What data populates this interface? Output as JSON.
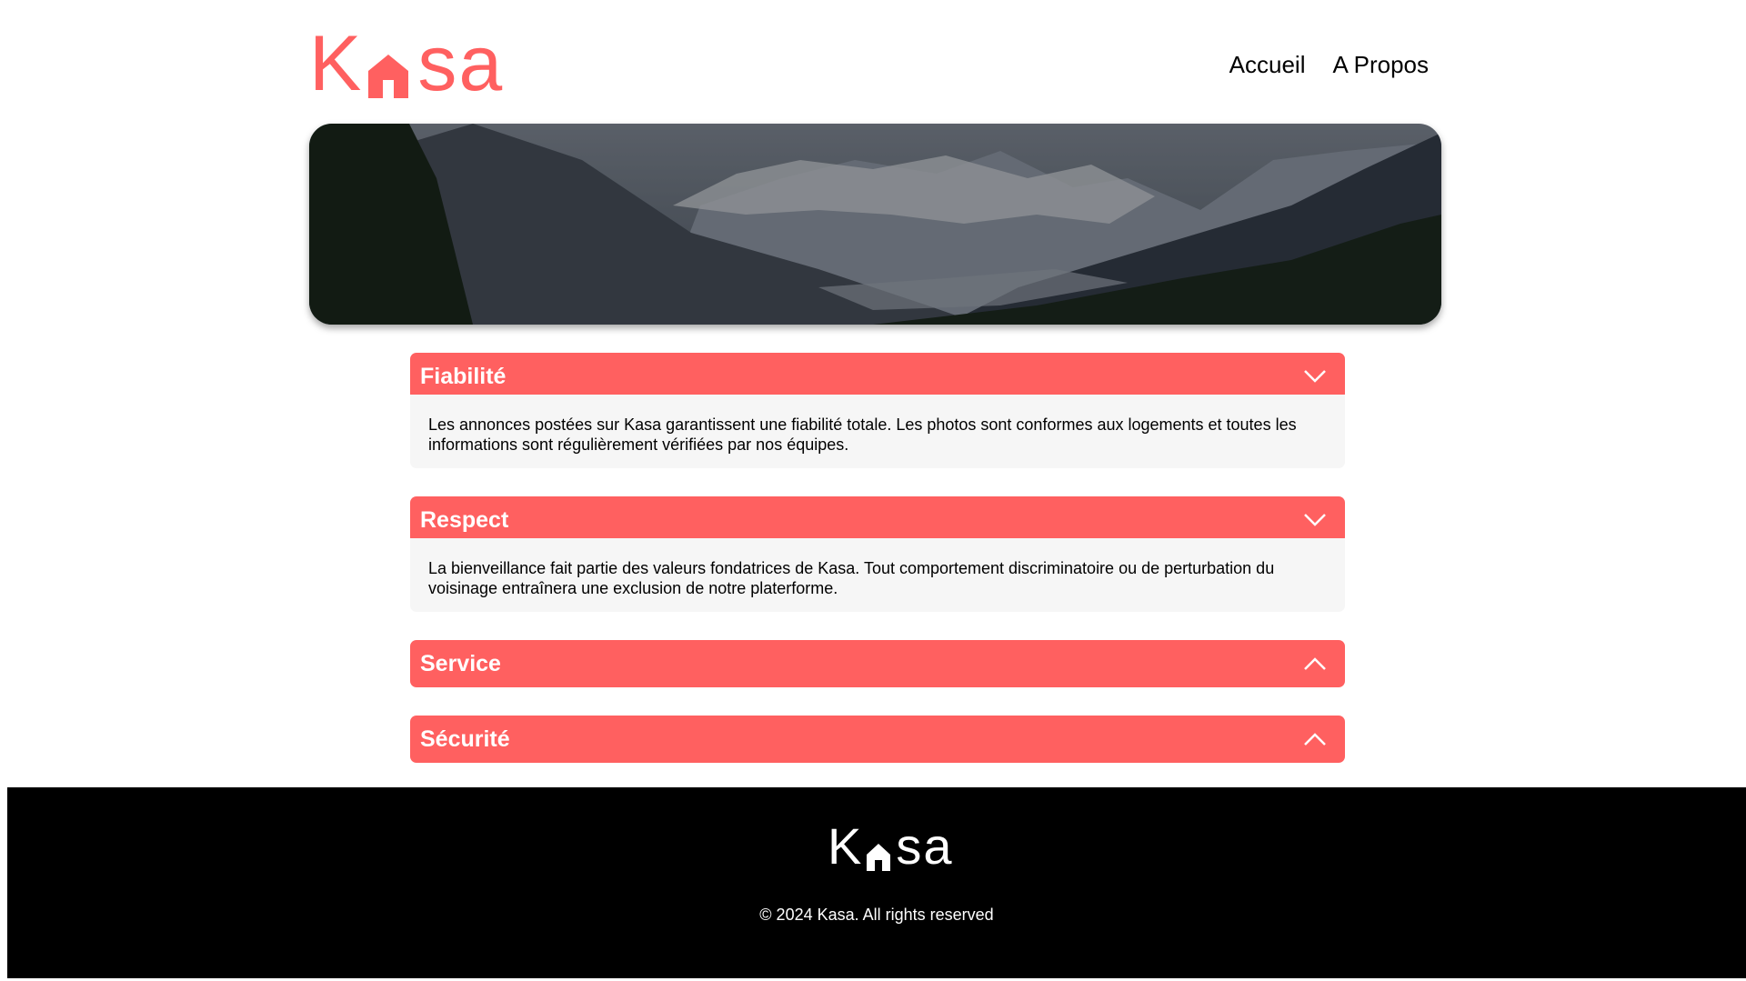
{
  "header": {
    "logo": {
      "text_before": "K",
      "text_after": "sa",
      "color": "#FF6060"
    },
    "nav": [
      {
        "label": "Accueil"
      },
      {
        "label": "A Propos"
      }
    ]
  },
  "banner": {
    "alt": "mountain-landscape"
  },
  "collapses": [
    {
      "title": "Fiabilité",
      "expanded": true,
      "content": "Les annonces postées sur Kasa garantissent une fiabilité totale. Les photos sont conformes aux logements et toutes les informations sont régulièrement vérifiées par nos équipes."
    },
    {
      "title": "Respect",
      "expanded": true,
      "content": "La bienveillance fait partie des valeurs fondatrices de Kasa. Tout comportement discriminatoire ou de perturbation du voisinage entraînera une exclusion de notre platerforme."
    },
    {
      "title": "Service",
      "expanded": false
    },
    {
      "title": "Sécurité",
      "expanded": false
    }
  ],
  "footer": {
    "logo": {
      "text_before": "K",
      "text_after": "sa"
    },
    "copyright": "© 2024 Kasa. All rights reserved"
  },
  "colors": {
    "accent": "#FF6060",
    "panel": "#F6F6F6",
    "footer_bg": "#000000"
  }
}
